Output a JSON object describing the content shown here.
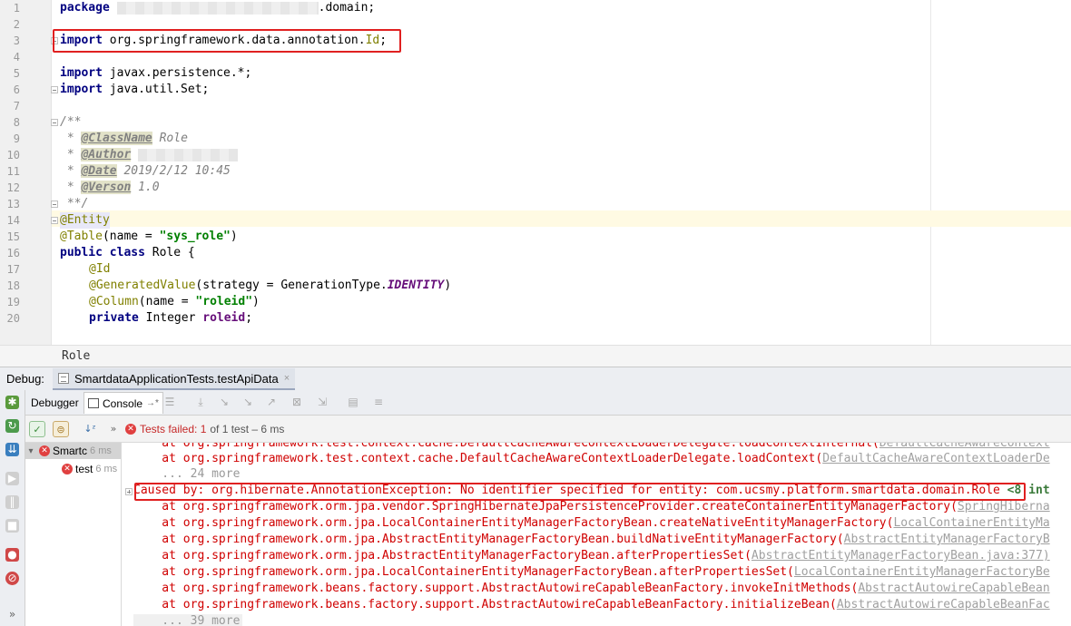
{
  "editor": {
    "line_numbers": [
      "1",
      "2",
      "3",
      "4",
      "5",
      "6",
      "7",
      "8",
      "9",
      "10",
      "11",
      "12",
      "13",
      "14",
      "15",
      "16",
      "17",
      "18",
      "19",
      "20"
    ],
    "line1": {
      "kw": "package",
      "suffix": ".domain;"
    },
    "line3": {
      "kw": "import",
      "path": " org.springframework.data.annotation.",
      "id": "Id",
      "semi": ";"
    },
    "line5": {
      "kw": "import",
      "rest": " javax.persistence.*;"
    },
    "line6": {
      "kw": "import",
      "rest": " java.util.Set;"
    },
    "line8": "/**",
    "line9": {
      "prefix": " * ",
      "tag": "@ClassName",
      "value": " Role"
    },
    "line10": {
      "prefix": " * ",
      "tag": "@Author"
    },
    "line11": {
      "prefix": " * ",
      "tag": "@Date",
      "value": " 2019/2/12 10:45"
    },
    "line12": {
      "prefix": " * ",
      "tag": "@Verson",
      "value": " 1.0"
    },
    "line13": " **/",
    "line14": "@Entity",
    "line15": {
      "ann": "@Table",
      "open": "(name = ",
      "str": "\"sys_role\"",
      "close": ")"
    },
    "line16": {
      "kw": "public class",
      "rest": " Role {"
    },
    "line17": "@Id",
    "line18": {
      "ann": "@GeneratedValue",
      "open": "(strategy = GenerationType.",
      "const": "IDENTITY",
      "close": ")"
    },
    "line19": {
      "ann": "@Column",
      "open": "(name = ",
      "str": "\"roleid\"",
      "close": ")"
    },
    "line20": {
      "kw": "private",
      "type": " Integer ",
      "field": "roleid",
      "semi": ";"
    }
  },
  "breadcrumb": "Role",
  "debug": {
    "title": "Debug:",
    "tab_label": "SmartdataApplicationTests.testApiData",
    "tab_close": "×",
    "subtab_debugger": "Debugger",
    "subtab_console": "Console",
    "subtab_console_arrow": "→*"
  },
  "test_status": {
    "prefix": "»",
    "label": "Tests failed: 1",
    "detail": "of 1 test – 6 ms"
  },
  "test_tree": [
    {
      "name": "Smartc",
      "time": "6 ms"
    },
    {
      "name": "test",
      "time": "6 ms"
    }
  ],
  "console": {
    "line1": {
      "text": "    at org.springframework.test.context.cache.DefaultCacheAwareContextLoaderDelegate.loadContextInternal(",
      "link": "DefaultCacheAwareContext"
    },
    "line2": {
      "text": "    at org.springframework.test.context.cache.DefaultCacheAwareContextLoaderDelegate.loadContext(",
      "link": "DefaultCacheAwareContextLoaderDe"
    },
    "line3": "    ... 24 more",
    "caused_by": "Caused by: org.hibernate.AnnotationException: No identifier specified for entity: com.ucsmy.platform.smartdata.domain.Role",
    "caused_suffix": " <8 int",
    "stack": [
      {
        "text": "    at org.springframework.orm.jpa.vendor.SpringHibernateJpaPersistenceProvider.createContainerEntityManagerFactory(",
        "link": "SpringHiberna"
      },
      {
        "text": "    at org.springframework.orm.jpa.LocalContainerEntityManagerFactoryBean.createNativeEntityManagerFactory(",
        "link": "LocalContainerEntityMa"
      },
      {
        "text": "    at org.springframework.orm.jpa.AbstractEntityManagerFactoryBean.buildNativeEntityManagerFactory(",
        "link": "AbstractEntityManagerFactoryB"
      },
      {
        "text": "    at org.springframework.orm.jpa.AbstractEntityManagerFactoryBean.afterPropertiesSet(",
        "link": "AbstractEntityManagerFactoryBean.java:377)"
      },
      {
        "text": "    at org.springframework.orm.jpa.LocalContainerEntityManagerFactoryBean.afterPropertiesSet(",
        "link": "LocalContainerEntityManagerFactoryBe"
      },
      {
        "text": "    at org.springframework.beans.factory.support.AbstractAutowireCapableBeanFactory.invokeInitMethods(",
        "link": "AbstractAutowireCapableBean"
      },
      {
        "text": "    at org.springframework.beans.factory.support.AbstractAutowireCapableBeanFactory.initializeBean(",
        "link": "AbstractAutowireCapableBeanFac"
      }
    ],
    "last": "    ... 39 more"
  },
  "colors": {
    "highlight": "#e02020",
    "error_text": "#d00000",
    "keyword": "#000080",
    "string": "#008000"
  }
}
